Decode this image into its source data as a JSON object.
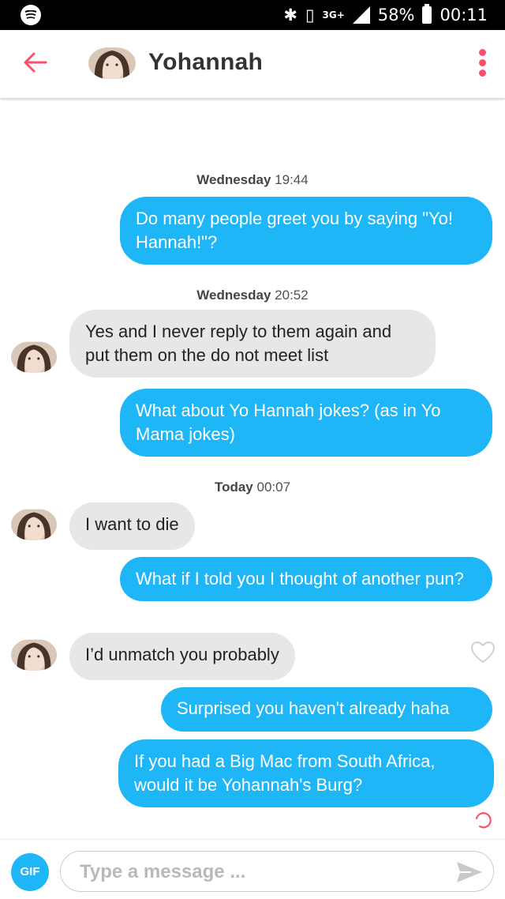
{
  "status_bar": {
    "network": "3G+",
    "battery": "58%",
    "time": "00:11"
  },
  "header": {
    "name": "Yohannah"
  },
  "messages": {
    "ts1": {
      "day": "Wednesday",
      "time": "19:44"
    },
    "m1": "Do many people greet you by saying \"Yo! Hannah!\"?",
    "ts2": {
      "day": "Wednesday",
      "time": "20:52"
    },
    "m2": "Yes and I never reply to them again and put them on the do not meet list",
    "m3": "What about Yo Hannah jokes? (as in Yo Mama jokes)",
    "ts3": {
      "day": "Today",
      "time": "00:07"
    },
    "m4": "I want to die",
    "m5": "What if I told you I thought of another pun?",
    "m6": "I’d unmatch you probably",
    "m7": "Surprised you haven't already haha",
    "m8": "If you had a Big Mac from South Africa, would it be Yohannah's Burg?"
  },
  "composer": {
    "gif_label": "GIF",
    "placeholder": "Type a message ..."
  },
  "colors": {
    "accent": "#fd5068",
    "sent_bubble": "#1fb6f7",
    "received_bubble": "#e7e7e7"
  }
}
